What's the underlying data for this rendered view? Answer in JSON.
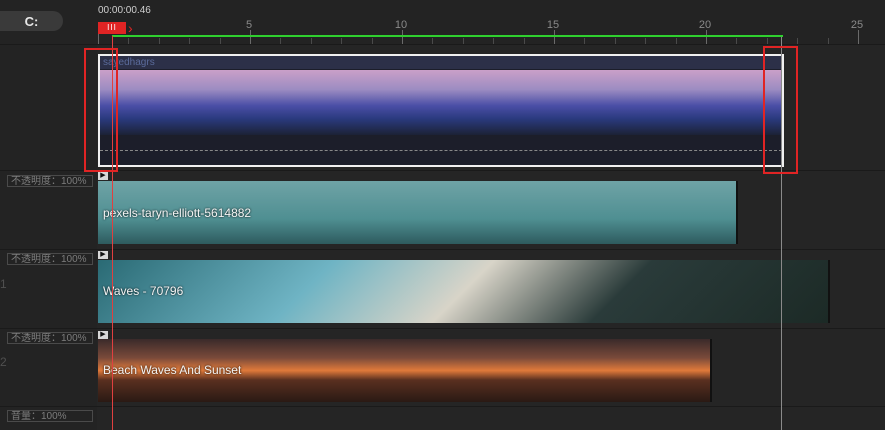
{
  "toolbar": {
    "snap_icon": "magnet-icon",
    "snap_glyph": "C:"
  },
  "ruler": {
    "timecode": "00:00:00.46",
    "marks": [
      "5",
      "10",
      "15",
      "20",
      "25"
    ],
    "playhead_icon": "playhead-icon",
    "playhead_glyph": "III",
    "play_icon": "play-arrow-icon",
    "play_glyph": "›"
  },
  "tracks": [
    {
      "id": "overlay",
      "clip_label": "sayedhagrs",
      "opacity": null,
      "number": ""
    },
    {
      "id": "video1",
      "opacity": "不透明度：100%",
      "clip_label": "pexels-taryn-elliott-5614882",
      "number": ""
    },
    {
      "id": "video2",
      "opacity": "不透明度：100%",
      "clip_label": "Waves - 70796",
      "number": "1"
    },
    {
      "id": "video3",
      "opacity": "不透明度：100%",
      "clip_label": "Beach Waves And Sunset",
      "number": "2"
    },
    {
      "id": "audio",
      "opacity": "音量：100%",
      "clip_label": "",
      "number": ""
    }
  ],
  "colors": {
    "playhead": "#e02424",
    "range": "#2fd02f"
  }
}
